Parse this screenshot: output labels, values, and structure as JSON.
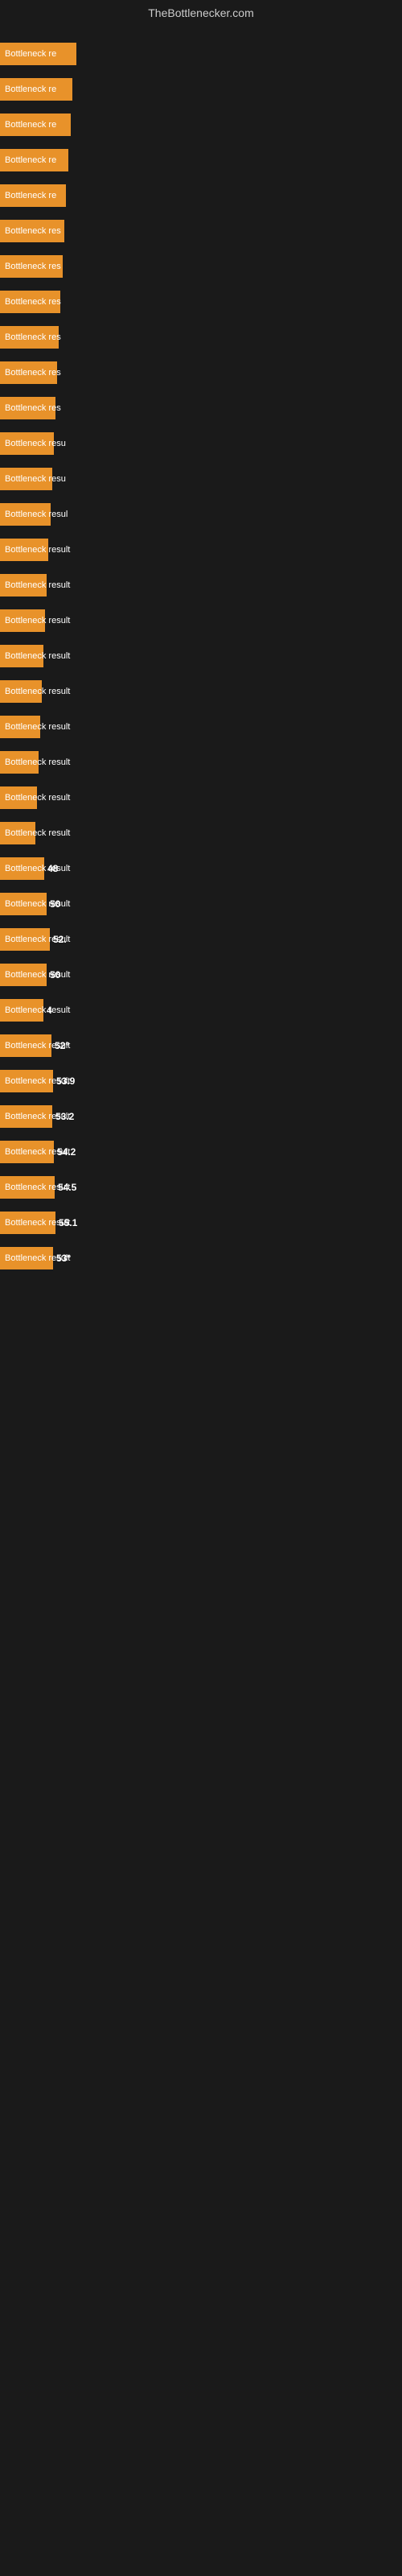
{
  "site": {
    "title": "TheBottlenecker.com"
  },
  "bars": [
    {
      "label": "Bottleneck re",
      "width": 95,
      "value": ""
    },
    {
      "label": "Bottleneck re",
      "width": 90,
      "value": ""
    },
    {
      "label": "Bottleneck re",
      "width": 88,
      "value": ""
    },
    {
      "label": "Bottleneck re",
      "width": 85,
      "value": ""
    },
    {
      "label": "Bottleneck re",
      "width": 82,
      "value": ""
    },
    {
      "label": "Bottleneck res",
      "width": 80,
      "value": ""
    },
    {
      "label": "Bottleneck res",
      "width": 78,
      "value": ""
    },
    {
      "label": "Bottleneck res",
      "width": 75,
      "value": ""
    },
    {
      "label": "Bottleneck res",
      "width": 73,
      "value": ""
    },
    {
      "label": "Bottleneck res",
      "width": 71,
      "value": ""
    },
    {
      "label": "Bottleneck res",
      "width": 69,
      "value": ""
    },
    {
      "label": "Bottleneck resu",
      "width": 67,
      "value": ""
    },
    {
      "label": "Bottleneck resu",
      "width": 65,
      "value": ""
    },
    {
      "label": "Bottleneck resul",
      "width": 63,
      "value": ""
    },
    {
      "label": "Bottleneck result",
      "width": 60,
      "value": ""
    },
    {
      "label": "Bottleneck result",
      "width": 58,
      "value": ""
    },
    {
      "label": "Bottleneck result",
      "width": 56,
      "value": ""
    },
    {
      "label": "Bottleneck result",
      "width": 54,
      "value": ""
    },
    {
      "label": "Bottleneck result",
      "width": 52,
      "value": ""
    },
    {
      "label": "Bottleneck result",
      "width": 50,
      "value": ""
    },
    {
      "label": "Bottleneck result",
      "width": 48,
      "value": ""
    },
    {
      "label": "Bottleneck result",
      "width": 46,
      "value": ""
    },
    {
      "label": "Bottleneck result",
      "width": 44,
      "value": ""
    },
    {
      "label": "Bottleneck result",
      "width": 55,
      "value": "48"
    },
    {
      "label": "Bottleneck result",
      "width": 58,
      "value": "50"
    },
    {
      "label": "Bottleneck result",
      "width": 62,
      "value": "52."
    },
    {
      "label": "Bottleneck result",
      "width": 58,
      "value": "50"
    },
    {
      "label": "Bottleneck result",
      "width": 54,
      "value": "4"
    },
    {
      "label": "Bottleneck result",
      "width": 64,
      "value": "52°"
    },
    {
      "label": "Bottleneck result",
      "width": 66,
      "value": "53.9"
    },
    {
      "label": "Bottleneck result",
      "width": 65,
      "value": "53.2"
    },
    {
      "label": "Bottleneck result",
      "width": 67,
      "value": "54.2"
    },
    {
      "label": "Bottleneck result",
      "width": 68,
      "value": "54.5"
    },
    {
      "label": "Bottleneck result",
      "width": 69,
      "value": "55.1"
    },
    {
      "label": "Bottleneck result",
      "width": 66,
      "value": "53°"
    }
  ]
}
